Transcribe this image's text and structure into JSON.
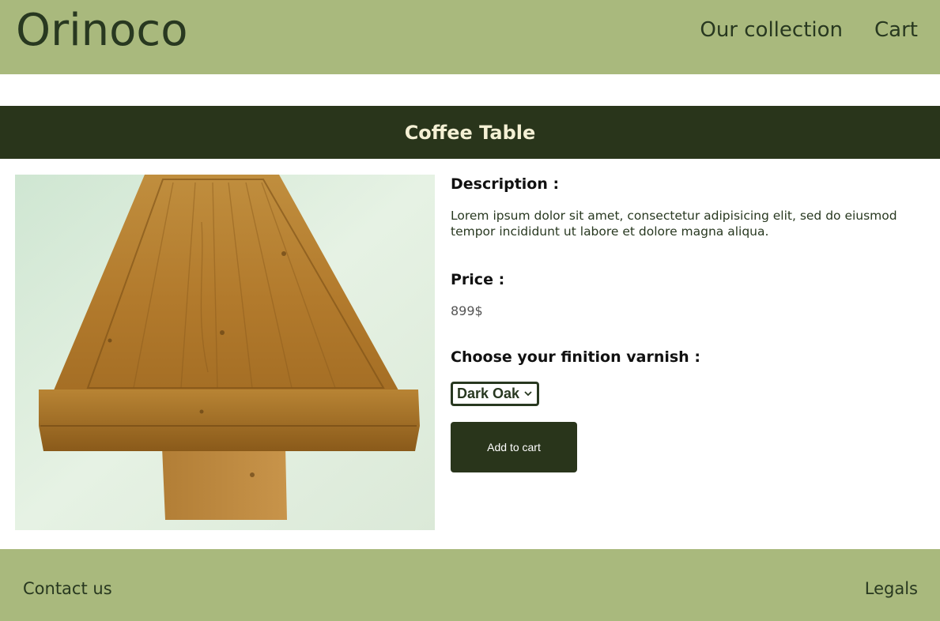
{
  "header": {
    "brand": "Orinoco",
    "nav": [
      {
        "label": "Our collection"
      },
      {
        "label": "Cart"
      }
    ]
  },
  "product": {
    "title": "Coffee Table",
    "image_alt": "wooden coffee table photo",
    "description_label": "Description :",
    "description": "Lorem ipsum dolor sit amet, consectetur adipisicing elit, sed do eiusmod tempor incididunt ut labore et dolore magna aliqua.",
    "price_label": "Price :",
    "price": "899$",
    "varnish_label": "Choose your finition varnish :",
    "varnish_selected": "Dark Oak",
    "add_to_cart": "Add to cart"
  },
  "footer": {
    "contact": "Contact us",
    "legals": "Legals"
  },
  "colors": {
    "header_bg": "#a9b97d",
    "dark_green": "#29351b",
    "title_text": "#f4f0d4"
  }
}
